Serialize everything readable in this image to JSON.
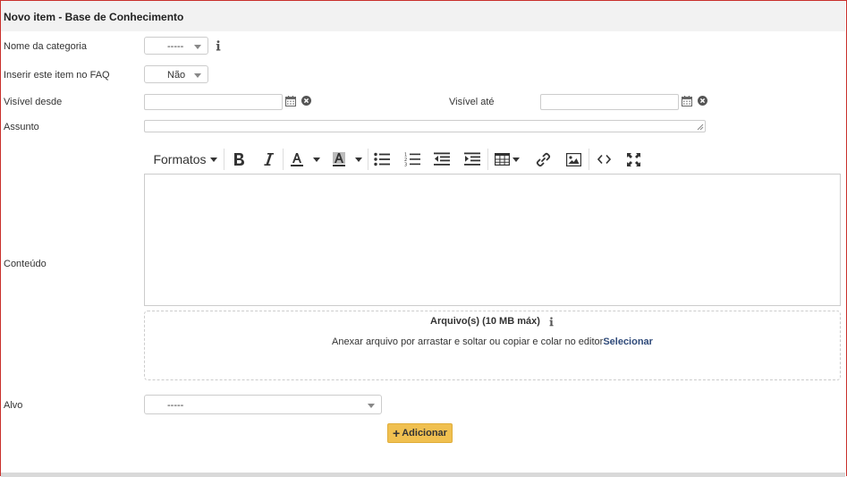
{
  "header": {
    "title": "Novo item - Base de Conhecimento"
  },
  "form": {
    "category": {
      "label": "Nome da categoria",
      "value": "-----"
    },
    "faq": {
      "label": "Inserir este item no FAQ",
      "value": "Não"
    },
    "visible_from": {
      "label": "Visível desde",
      "value": ""
    },
    "visible_until": {
      "label": "Visível até",
      "value": ""
    },
    "subject": {
      "label": "Assunto",
      "value": ""
    },
    "content": {
      "label": "Conteúdo"
    },
    "target": {
      "label": "Alvo",
      "value": "-----"
    }
  },
  "toolbar": {
    "formats_label": "Formatos"
  },
  "attachments": {
    "title": "Arquivo(s) (10 MB máx)",
    "text": "Anexar arquivo por arrastar e soltar ou copiar e colar no editor",
    "link": "Selecionar"
  },
  "actions": {
    "add_label": "Adicionar"
  },
  "colors": {
    "accent": "#f0c050",
    "border_frame": "#c9302c",
    "link": "#2f4a7a"
  }
}
